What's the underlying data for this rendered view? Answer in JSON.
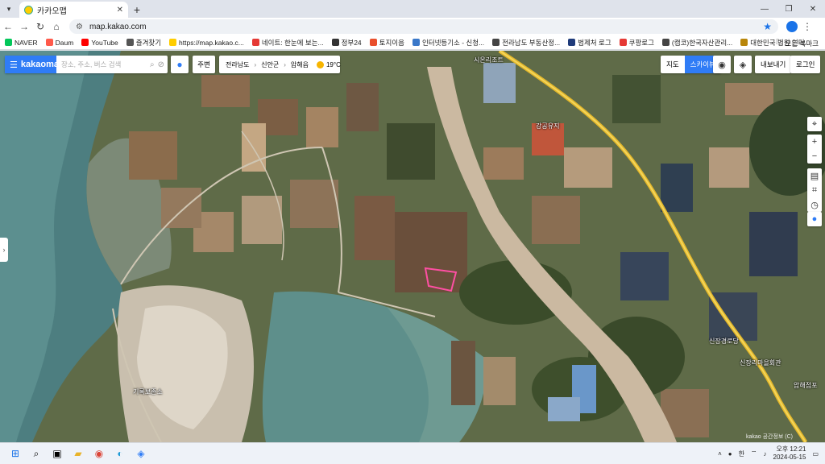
{
  "browser": {
    "tab_title": "카카오맵",
    "url": "map.kakao.com",
    "bookmarks": [
      {
        "label": "NAVER",
        "color": "#03c75a"
      },
      {
        "label": "Daum",
        "color": "#ff5a4b"
      },
      {
        "label": "YouTube",
        "color": "#ff0000"
      },
      {
        "label": "즐겨찾기",
        "color": "#555555"
      },
      {
        "label": "https://map.kakao.c...",
        "color": "#ffcd00"
      },
      {
        "label": "네이트: 한눈에 보는...",
        "color": "#e53935"
      },
      {
        "label": "정부24",
        "color": "#333333"
      },
      {
        "label": "토지이음",
        "color": "#e94f2c"
      },
      {
        "label": "인터넷등기소 - 신청...",
        "color": "#3a78c9"
      },
      {
        "label": "전라남도 부동산정...",
        "color": "#444444"
      },
      {
        "label": "범제처 로그",
        "color": "#1f3b7a"
      },
      {
        "label": "쿠팡로그",
        "color": "#e53935"
      },
      {
        "label": "(캠코)한국자산관리...",
        "color": "#444444"
      },
      {
        "label": "대한민국 법원 인터...",
        "color": "#b8860b"
      }
    ],
    "bookmarks_folder": "모든 북마크"
  },
  "map": {
    "brand": "kakaomap",
    "search_placeholder": "장소, 주소, 버스 검색",
    "nearby_label": "주변",
    "breadcrumb": [
      "전라남도",
      "신안군",
      "압해읍"
    ],
    "weather_temp": "19°C",
    "map_type_options": [
      "지도",
      "스카이뷰"
    ],
    "map_type_selected": "스카이뷰",
    "share_label": "내보내기",
    "login_label": "로그인",
    "place_labels": [
      "시온리조트",
      "강공유지",
      "기록보존소",
      "신장경로당",
      "신장리마을회관",
      "압해점포"
    ],
    "copyright": "kakao 공간정보 (C)"
  },
  "taskbar": {
    "ime": "한",
    "time": "오후 12:21",
    "date": "2024-05-15"
  }
}
